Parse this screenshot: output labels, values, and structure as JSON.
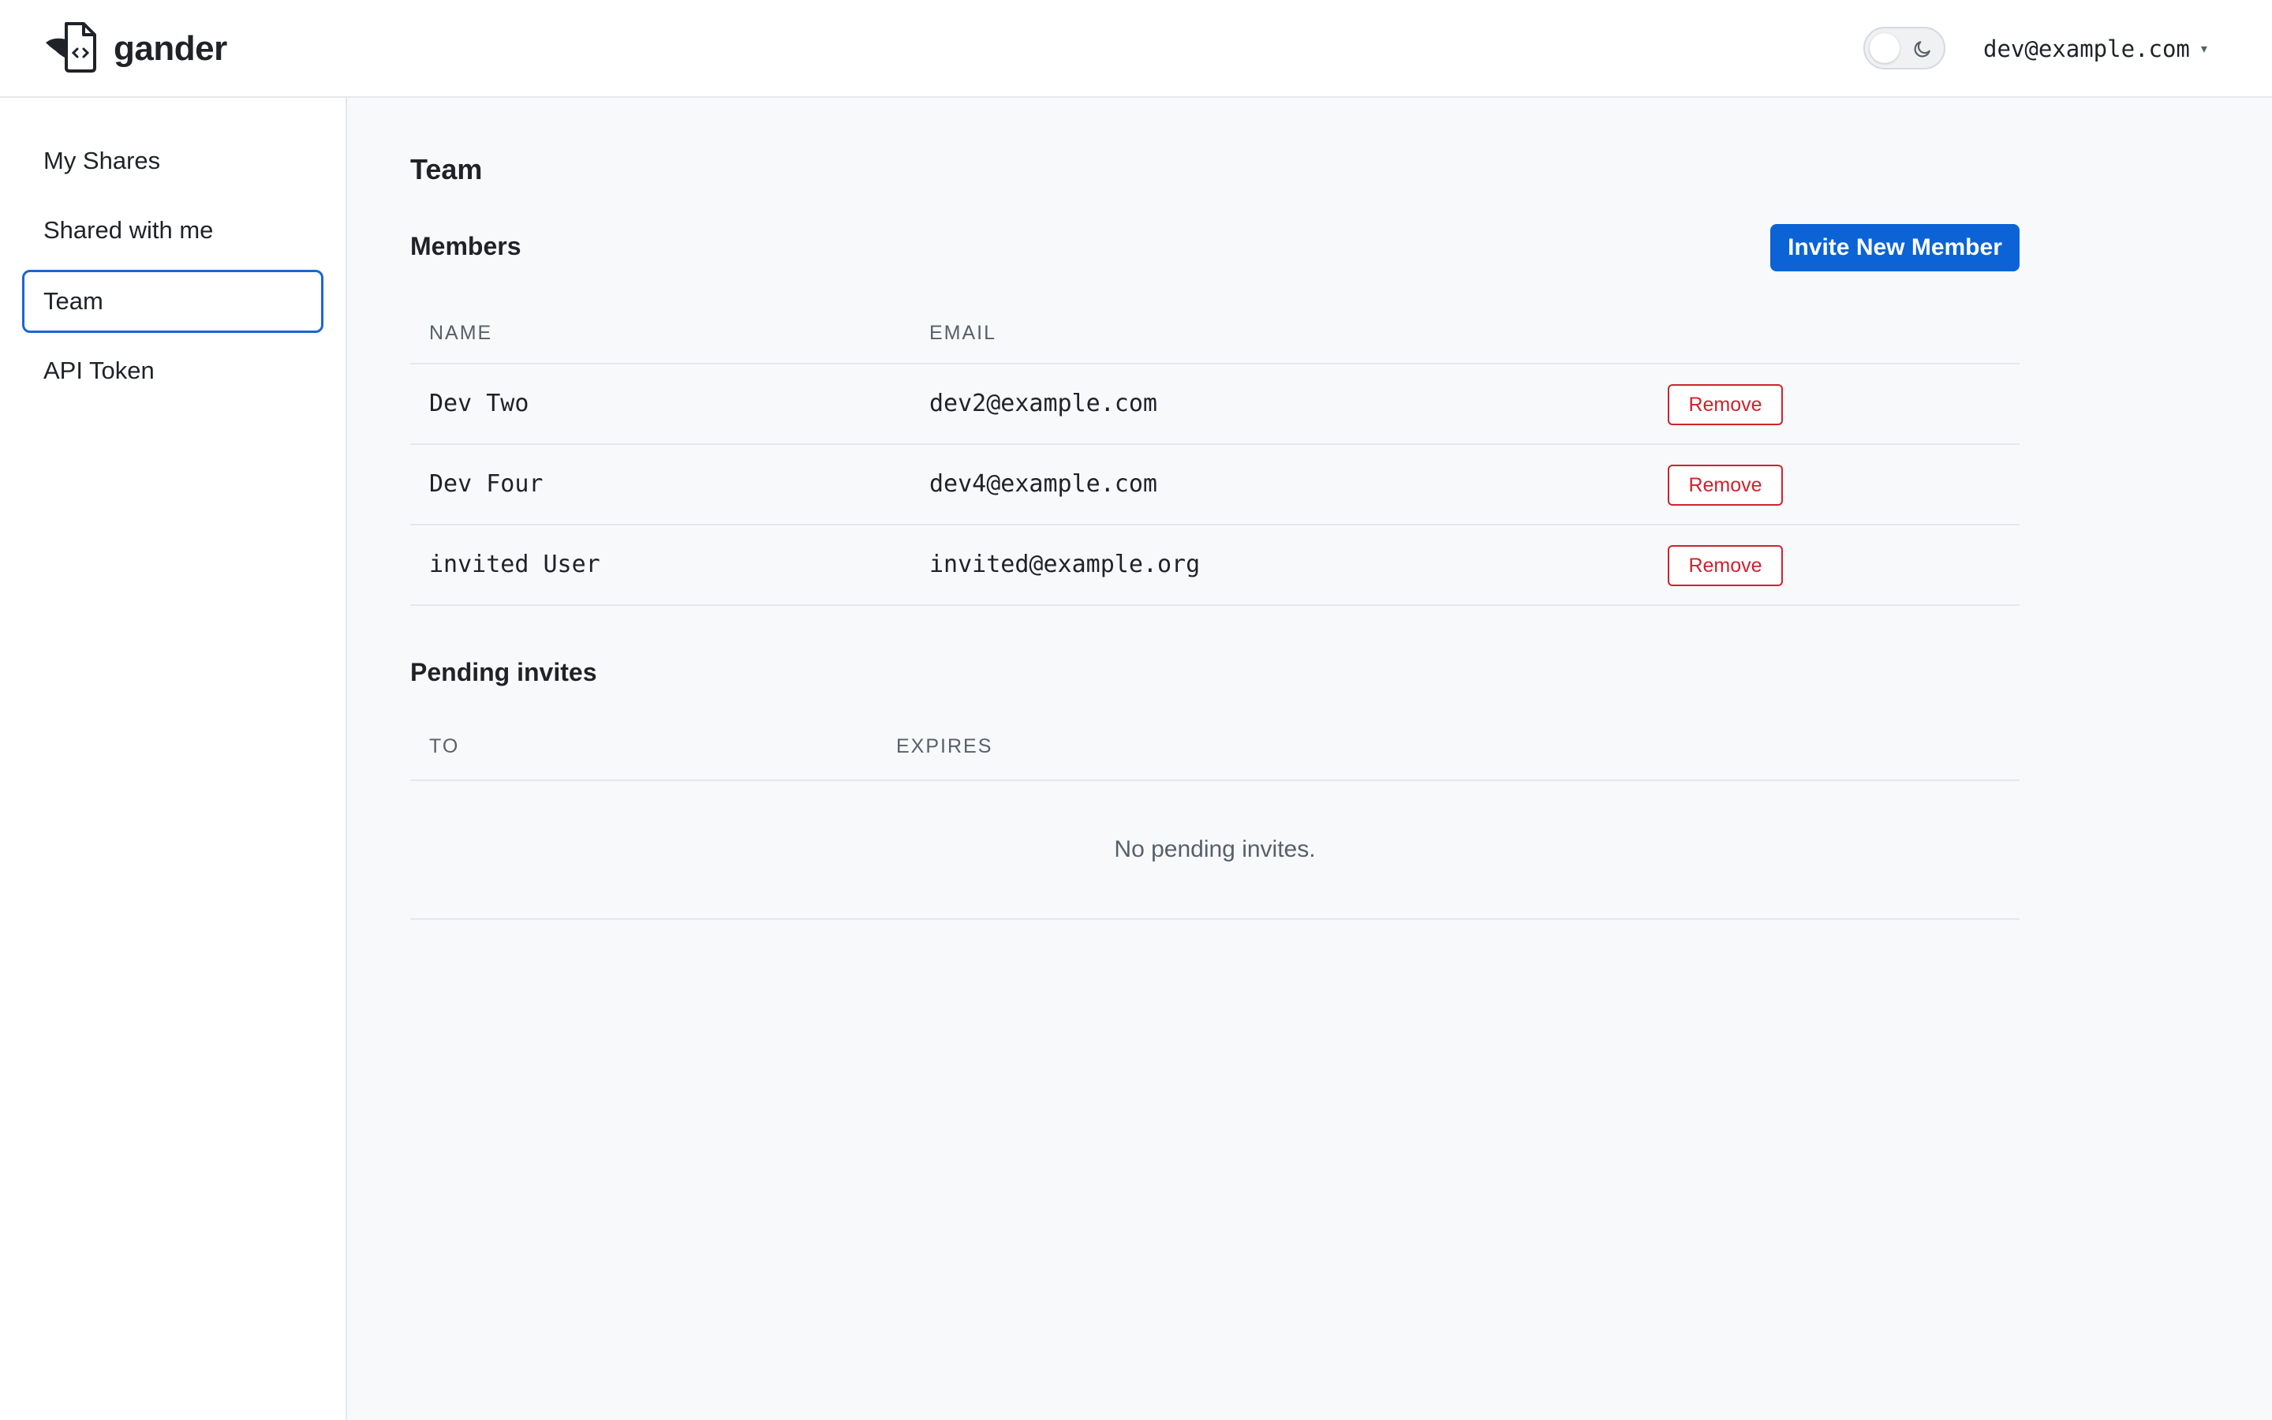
{
  "header": {
    "app_name": "gander",
    "logo_icon": "gander-file-logo-icon",
    "theme_toggle_icon": "moon-icon",
    "user_email": "dev@example.com",
    "user_menu_caret": "▾"
  },
  "sidebar": {
    "items": [
      {
        "label": "My Shares",
        "active": false
      },
      {
        "label": "Shared with me",
        "active": false
      },
      {
        "label": "Team",
        "active": true
      },
      {
        "label": "API Token",
        "active": false
      }
    ]
  },
  "main": {
    "title": "Team",
    "members": {
      "title": "Members",
      "invite_button": "Invite New Member",
      "columns": [
        "NAME",
        "EMAIL"
      ],
      "rows": [
        {
          "name": "Dev Two",
          "email": "dev2@example.com",
          "action": "Remove"
        },
        {
          "name": "Dev Four",
          "email": "dev4@example.com",
          "action": "Remove"
        },
        {
          "name": "invited User",
          "email": "invited@example.org",
          "action": "Remove"
        }
      ]
    },
    "pending": {
      "title": "Pending invites",
      "columns": [
        "TO",
        "EXPIRES"
      ],
      "empty_text": "No pending invites."
    }
  },
  "colors": {
    "accent": "#0b63d6",
    "danger": "#cf222e",
    "background": "#f8f9fb"
  }
}
